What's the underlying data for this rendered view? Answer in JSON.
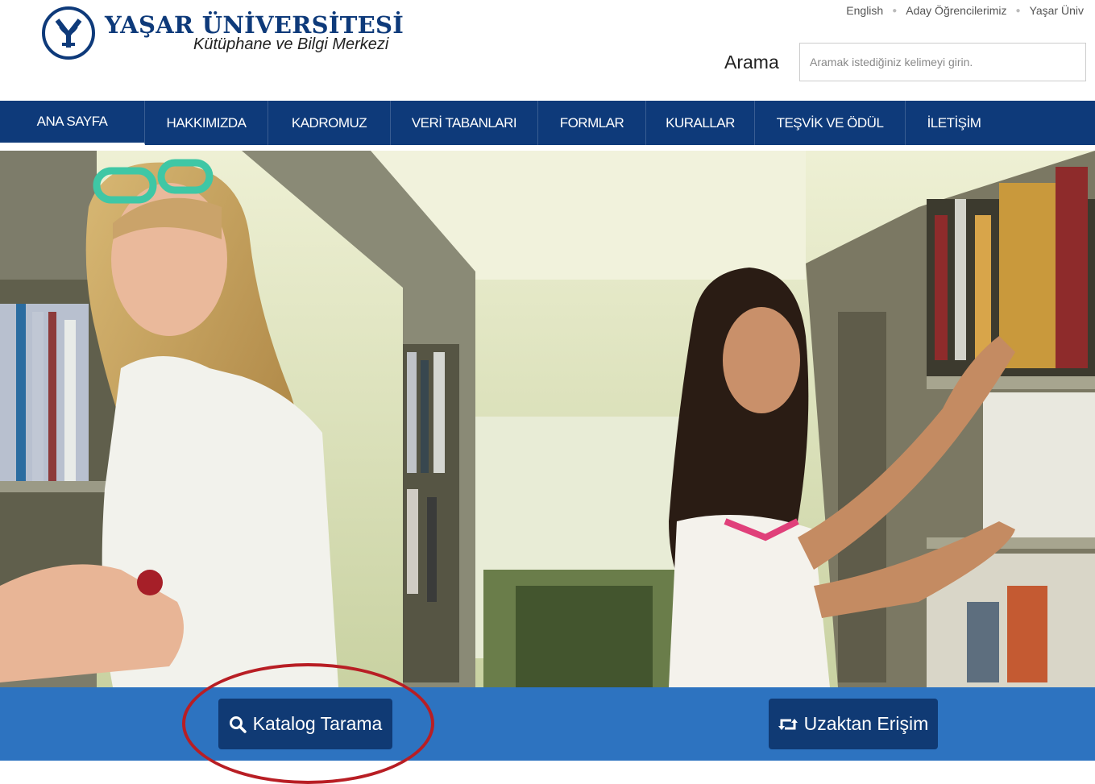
{
  "header": {
    "logo_name": "YAŞAR ÜNİVERSİTESİ",
    "logo_subtitle": "Kütüphane ve Bilgi Merkezi",
    "top_links": [
      "English",
      "Aday Öğrencilerimiz",
      "Yaşar Üniv"
    ],
    "search_label": "Arama",
    "search_placeholder": "Aramak istediğiniz kelimeyi girin."
  },
  "nav": {
    "items": [
      {
        "label": "ANA SAYFA",
        "active": true
      },
      {
        "label": "HAKKIMIZDA"
      },
      {
        "label": "KADROMUZ"
      },
      {
        "label": "VERİ TABANLARI"
      },
      {
        "label": "FORMLAR"
      },
      {
        "label": "KURALLAR"
      },
      {
        "label": "TEŞVİK VE ÖDÜL"
      },
      {
        "label": "İLETİŞİM"
      }
    ]
  },
  "actions": {
    "catalog": {
      "label": "Katalog Tarama",
      "icon": "search-icon"
    },
    "remote": {
      "label": "Uzaktan Erişim",
      "icon": "retweet-icon"
    }
  },
  "colors": {
    "brand": "#0e3a7a",
    "band": "#2d73c0",
    "button": "#103a74",
    "annotation": "#b81e24"
  }
}
